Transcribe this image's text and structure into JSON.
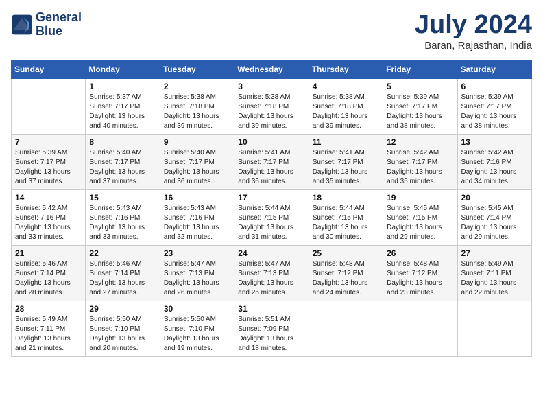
{
  "header": {
    "logo_line1": "General",
    "logo_line2": "Blue",
    "month_title": "July 2024",
    "location": "Baran, Rajasthan, India"
  },
  "days_of_week": [
    "Sunday",
    "Monday",
    "Tuesday",
    "Wednesday",
    "Thursday",
    "Friday",
    "Saturday"
  ],
  "weeks": [
    [
      {
        "num": "",
        "info": ""
      },
      {
        "num": "1",
        "info": "Sunrise: 5:37 AM\nSunset: 7:17 PM\nDaylight: 13 hours\nand 40 minutes."
      },
      {
        "num": "2",
        "info": "Sunrise: 5:38 AM\nSunset: 7:18 PM\nDaylight: 13 hours\nand 39 minutes."
      },
      {
        "num": "3",
        "info": "Sunrise: 5:38 AM\nSunset: 7:18 PM\nDaylight: 13 hours\nand 39 minutes."
      },
      {
        "num": "4",
        "info": "Sunrise: 5:38 AM\nSunset: 7:18 PM\nDaylight: 13 hours\nand 39 minutes."
      },
      {
        "num": "5",
        "info": "Sunrise: 5:39 AM\nSunset: 7:17 PM\nDaylight: 13 hours\nand 38 minutes."
      },
      {
        "num": "6",
        "info": "Sunrise: 5:39 AM\nSunset: 7:17 PM\nDaylight: 13 hours\nand 38 minutes."
      }
    ],
    [
      {
        "num": "7",
        "info": "Sunrise: 5:39 AM\nSunset: 7:17 PM\nDaylight: 13 hours\nand 37 minutes."
      },
      {
        "num": "8",
        "info": "Sunrise: 5:40 AM\nSunset: 7:17 PM\nDaylight: 13 hours\nand 37 minutes."
      },
      {
        "num": "9",
        "info": "Sunrise: 5:40 AM\nSunset: 7:17 PM\nDaylight: 13 hours\nand 36 minutes."
      },
      {
        "num": "10",
        "info": "Sunrise: 5:41 AM\nSunset: 7:17 PM\nDaylight: 13 hours\nand 36 minutes."
      },
      {
        "num": "11",
        "info": "Sunrise: 5:41 AM\nSunset: 7:17 PM\nDaylight: 13 hours\nand 35 minutes."
      },
      {
        "num": "12",
        "info": "Sunrise: 5:42 AM\nSunset: 7:17 PM\nDaylight: 13 hours\nand 35 minutes."
      },
      {
        "num": "13",
        "info": "Sunrise: 5:42 AM\nSunset: 7:16 PM\nDaylight: 13 hours\nand 34 minutes."
      }
    ],
    [
      {
        "num": "14",
        "info": "Sunrise: 5:42 AM\nSunset: 7:16 PM\nDaylight: 13 hours\nand 33 minutes."
      },
      {
        "num": "15",
        "info": "Sunrise: 5:43 AM\nSunset: 7:16 PM\nDaylight: 13 hours\nand 33 minutes."
      },
      {
        "num": "16",
        "info": "Sunrise: 5:43 AM\nSunset: 7:16 PM\nDaylight: 13 hours\nand 32 minutes."
      },
      {
        "num": "17",
        "info": "Sunrise: 5:44 AM\nSunset: 7:15 PM\nDaylight: 13 hours\nand 31 minutes."
      },
      {
        "num": "18",
        "info": "Sunrise: 5:44 AM\nSunset: 7:15 PM\nDaylight: 13 hours\nand 30 minutes."
      },
      {
        "num": "19",
        "info": "Sunrise: 5:45 AM\nSunset: 7:15 PM\nDaylight: 13 hours\nand 29 minutes."
      },
      {
        "num": "20",
        "info": "Sunrise: 5:45 AM\nSunset: 7:14 PM\nDaylight: 13 hours\nand 29 minutes."
      }
    ],
    [
      {
        "num": "21",
        "info": "Sunrise: 5:46 AM\nSunset: 7:14 PM\nDaylight: 13 hours\nand 28 minutes."
      },
      {
        "num": "22",
        "info": "Sunrise: 5:46 AM\nSunset: 7:14 PM\nDaylight: 13 hours\nand 27 minutes."
      },
      {
        "num": "23",
        "info": "Sunrise: 5:47 AM\nSunset: 7:13 PM\nDaylight: 13 hours\nand 26 minutes."
      },
      {
        "num": "24",
        "info": "Sunrise: 5:47 AM\nSunset: 7:13 PM\nDaylight: 13 hours\nand 25 minutes."
      },
      {
        "num": "25",
        "info": "Sunrise: 5:48 AM\nSunset: 7:12 PM\nDaylight: 13 hours\nand 24 minutes."
      },
      {
        "num": "26",
        "info": "Sunrise: 5:48 AM\nSunset: 7:12 PM\nDaylight: 13 hours\nand 23 minutes."
      },
      {
        "num": "27",
        "info": "Sunrise: 5:49 AM\nSunset: 7:11 PM\nDaylight: 13 hours\nand 22 minutes."
      }
    ],
    [
      {
        "num": "28",
        "info": "Sunrise: 5:49 AM\nSunset: 7:11 PM\nDaylight: 13 hours\nand 21 minutes."
      },
      {
        "num": "29",
        "info": "Sunrise: 5:50 AM\nSunset: 7:10 PM\nDaylight: 13 hours\nand 20 minutes."
      },
      {
        "num": "30",
        "info": "Sunrise: 5:50 AM\nSunset: 7:10 PM\nDaylight: 13 hours\nand 19 minutes."
      },
      {
        "num": "31",
        "info": "Sunrise: 5:51 AM\nSunset: 7:09 PM\nDaylight: 13 hours\nand 18 minutes."
      },
      {
        "num": "",
        "info": ""
      },
      {
        "num": "",
        "info": ""
      },
      {
        "num": "",
        "info": ""
      }
    ]
  ]
}
